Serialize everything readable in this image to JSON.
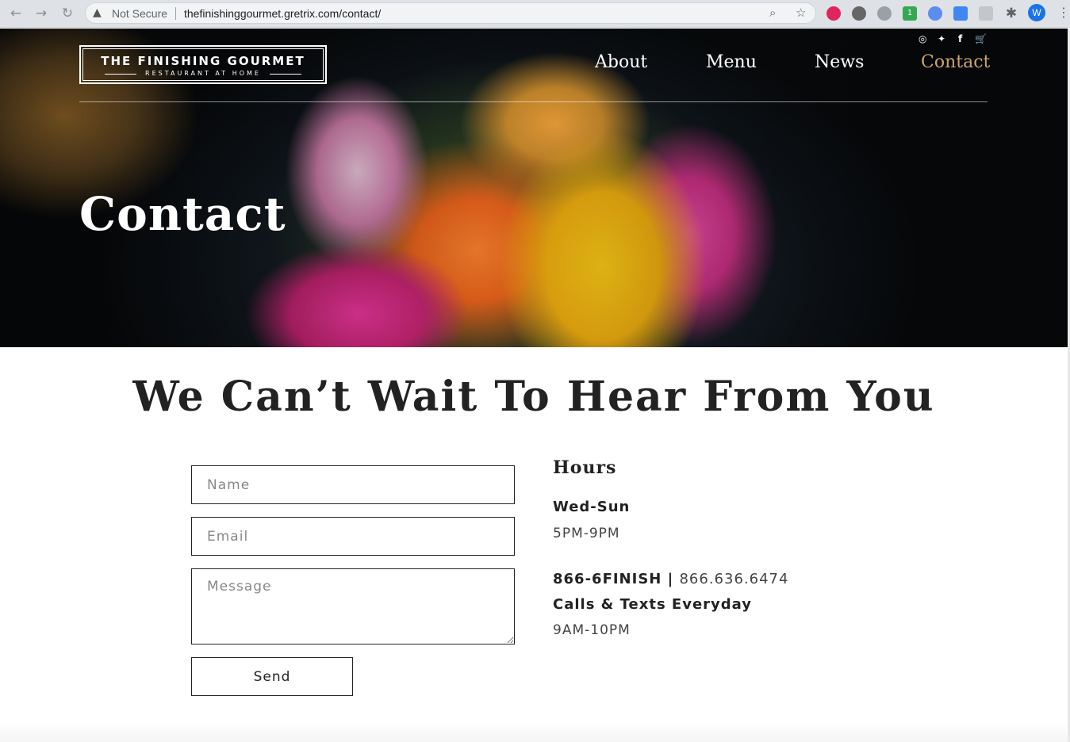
{
  "browser": {
    "back_icon": "←",
    "forward_icon": "→",
    "reload_icon": "↻",
    "warning_icon": "▲",
    "security_label": "Not Secure",
    "url": "thefinishinggourmet.gretrix.com/contact/",
    "zoom_icon": "⌕",
    "star_icon": "☆",
    "extensions_icon": "✱",
    "profile_initial": "W",
    "menu_icon": "⋮",
    "ext_badge": "1"
  },
  "header": {
    "logo_main": "THE FINISHING GOURMET",
    "logo_sub": "RESTAURANT AT HOME",
    "social": {
      "instagram": "◎",
      "twitter": "✦",
      "facebook": "f",
      "cart": "🛒"
    },
    "nav": [
      {
        "label": "About"
      },
      {
        "label": "Menu"
      },
      {
        "label": "News"
      },
      {
        "label": "Contact",
        "active": true
      }
    ]
  },
  "hero": {
    "title": "Contact"
  },
  "main": {
    "headline": "We Can’t Wait To Hear From You",
    "form": {
      "name_placeholder": "Name",
      "email_placeholder": "Email",
      "message_placeholder": "Message",
      "send_label": "Send"
    },
    "info": {
      "hours_title": "Hours",
      "days": "Wed-Sun",
      "times": "5PM-9PM",
      "phone_word": "866-6FINISH",
      "phone_sep": " | ",
      "phone_number": "866.636.6474",
      "calls_label": "Calls & Texts Everyday",
      "calls_times": "9AM-10PM"
    }
  },
  "colors": {
    "accent": "#c9a46a",
    "text": "#222222"
  }
}
